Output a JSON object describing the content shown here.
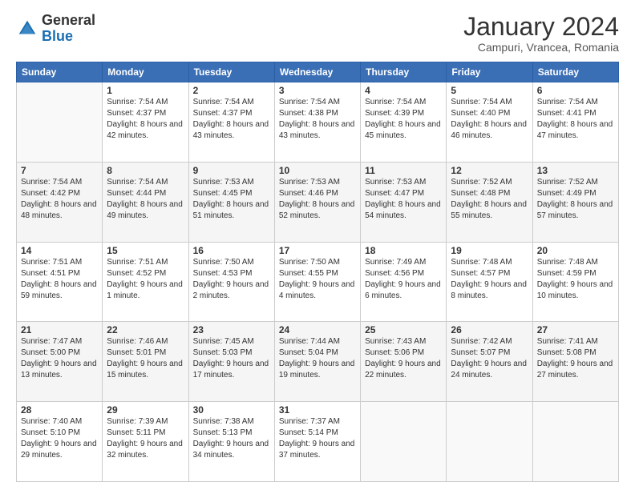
{
  "header": {
    "logo_general": "General",
    "logo_blue": "Blue",
    "title": "January 2024",
    "subtitle": "Campuri, Vrancea, Romania"
  },
  "days_of_week": [
    "Sunday",
    "Monday",
    "Tuesday",
    "Wednesday",
    "Thursday",
    "Friday",
    "Saturday"
  ],
  "weeks": [
    [
      {
        "num": "",
        "sunrise": "",
        "sunset": "",
        "daylight": ""
      },
      {
        "num": "1",
        "sunrise": "Sunrise: 7:54 AM",
        "sunset": "Sunset: 4:37 PM",
        "daylight": "Daylight: 8 hours and 42 minutes."
      },
      {
        "num": "2",
        "sunrise": "Sunrise: 7:54 AM",
        "sunset": "Sunset: 4:37 PM",
        "daylight": "Daylight: 8 hours and 43 minutes."
      },
      {
        "num": "3",
        "sunrise": "Sunrise: 7:54 AM",
        "sunset": "Sunset: 4:38 PM",
        "daylight": "Daylight: 8 hours and 43 minutes."
      },
      {
        "num": "4",
        "sunrise": "Sunrise: 7:54 AM",
        "sunset": "Sunset: 4:39 PM",
        "daylight": "Daylight: 8 hours and 45 minutes."
      },
      {
        "num": "5",
        "sunrise": "Sunrise: 7:54 AM",
        "sunset": "Sunset: 4:40 PM",
        "daylight": "Daylight: 8 hours and 46 minutes."
      },
      {
        "num": "6",
        "sunrise": "Sunrise: 7:54 AM",
        "sunset": "Sunset: 4:41 PM",
        "daylight": "Daylight: 8 hours and 47 minutes."
      }
    ],
    [
      {
        "num": "7",
        "sunrise": "Sunrise: 7:54 AM",
        "sunset": "Sunset: 4:42 PM",
        "daylight": "Daylight: 8 hours and 48 minutes."
      },
      {
        "num": "8",
        "sunrise": "Sunrise: 7:54 AM",
        "sunset": "Sunset: 4:44 PM",
        "daylight": "Daylight: 8 hours and 49 minutes."
      },
      {
        "num": "9",
        "sunrise": "Sunrise: 7:53 AM",
        "sunset": "Sunset: 4:45 PM",
        "daylight": "Daylight: 8 hours and 51 minutes."
      },
      {
        "num": "10",
        "sunrise": "Sunrise: 7:53 AM",
        "sunset": "Sunset: 4:46 PM",
        "daylight": "Daylight: 8 hours and 52 minutes."
      },
      {
        "num": "11",
        "sunrise": "Sunrise: 7:53 AM",
        "sunset": "Sunset: 4:47 PM",
        "daylight": "Daylight: 8 hours and 54 minutes."
      },
      {
        "num": "12",
        "sunrise": "Sunrise: 7:52 AM",
        "sunset": "Sunset: 4:48 PM",
        "daylight": "Daylight: 8 hours and 55 minutes."
      },
      {
        "num": "13",
        "sunrise": "Sunrise: 7:52 AM",
        "sunset": "Sunset: 4:49 PM",
        "daylight": "Daylight: 8 hours and 57 minutes."
      }
    ],
    [
      {
        "num": "14",
        "sunrise": "Sunrise: 7:51 AM",
        "sunset": "Sunset: 4:51 PM",
        "daylight": "Daylight: 8 hours and 59 minutes."
      },
      {
        "num": "15",
        "sunrise": "Sunrise: 7:51 AM",
        "sunset": "Sunset: 4:52 PM",
        "daylight": "Daylight: 9 hours and 1 minute."
      },
      {
        "num": "16",
        "sunrise": "Sunrise: 7:50 AM",
        "sunset": "Sunset: 4:53 PM",
        "daylight": "Daylight: 9 hours and 2 minutes."
      },
      {
        "num": "17",
        "sunrise": "Sunrise: 7:50 AM",
        "sunset": "Sunset: 4:55 PM",
        "daylight": "Daylight: 9 hours and 4 minutes."
      },
      {
        "num": "18",
        "sunrise": "Sunrise: 7:49 AM",
        "sunset": "Sunset: 4:56 PM",
        "daylight": "Daylight: 9 hours and 6 minutes."
      },
      {
        "num": "19",
        "sunrise": "Sunrise: 7:48 AM",
        "sunset": "Sunset: 4:57 PM",
        "daylight": "Daylight: 9 hours and 8 minutes."
      },
      {
        "num": "20",
        "sunrise": "Sunrise: 7:48 AM",
        "sunset": "Sunset: 4:59 PM",
        "daylight": "Daylight: 9 hours and 10 minutes."
      }
    ],
    [
      {
        "num": "21",
        "sunrise": "Sunrise: 7:47 AM",
        "sunset": "Sunset: 5:00 PM",
        "daylight": "Daylight: 9 hours and 13 minutes."
      },
      {
        "num": "22",
        "sunrise": "Sunrise: 7:46 AM",
        "sunset": "Sunset: 5:01 PM",
        "daylight": "Daylight: 9 hours and 15 minutes."
      },
      {
        "num": "23",
        "sunrise": "Sunrise: 7:45 AM",
        "sunset": "Sunset: 5:03 PM",
        "daylight": "Daylight: 9 hours and 17 minutes."
      },
      {
        "num": "24",
        "sunrise": "Sunrise: 7:44 AM",
        "sunset": "Sunset: 5:04 PM",
        "daylight": "Daylight: 9 hours and 19 minutes."
      },
      {
        "num": "25",
        "sunrise": "Sunrise: 7:43 AM",
        "sunset": "Sunset: 5:06 PM",
        "daylight": "Daylight: 9 hours and 22 minutes."
      },
      {
        "num": "26",
        "sunrise": "Sunrise: 7:42 AM",
        "sunset": "Sunset: 5:07 PM",
        "daylight": "Daylight: 9 hours and 24 minutes."
      },
      {
        "num": "27",
        "sunrise": "Sunrise: 7:41 AM",
        "sunset": "Sunset: 5:08 PM",
        "daylight": "Daylight: 9 hours and 27 minutes."
      }
    ],
    [
      {
        "num": "28",
        "sunrise": "Sunrise: 7:40 AM",
        "sunset": "Sunset: 5:10 PM",
        "daylight": "Daylight: 9 hours and 29 minutes."
      },
      {
        "num": "29",
        "sunrise": "Sunrise: 7:39 AM",
        "sunset": "Sunset: 5:11 PM",
        "daylight": "Daylight: 9 hours and 32 minutes."
      },
      {
        "num": "30",
        "sunrise": "Sunrise: 7:38 AM",
        "sunset": "Sunset: 5:13 PM",
        "daylight": "Daylight: 9 hours and 34 minutes."
      },
      {
        "num": "31",
        "sunrise": "Sunrise: 7:37 AM",
        "sunset": "Sunset: 5:14 PM",
        "daylight": "Daylight: 9 hours and 37 minutes."
      },
      {
        "num": "",
        "sunrise": "",
        "sunset": "",
        "daylight": ""
      },
      {
        "num": "",
        "sunrise": "",
        "sunset": "",
        "daylight": ""
      },
      {
        "num": "",
        "sunrise": "",
        "sunset": "",
        "daylight": ""
      }
    ]
  ]
}
